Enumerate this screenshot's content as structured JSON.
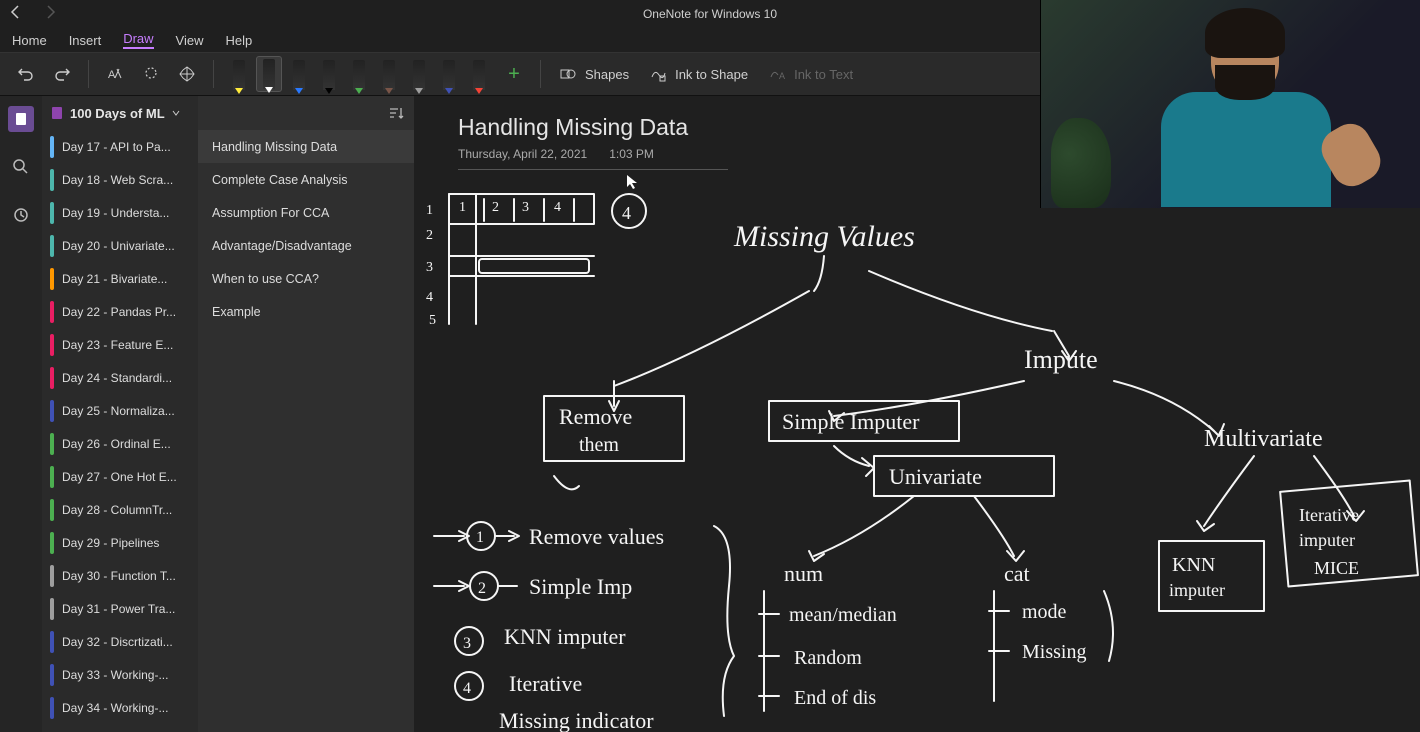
{
  "app_title": "OneNote for Windows 10",
  "menu": {
    "home": "Home",
    "insert": "Insert",
    "draw": "Draw",
    "view": "View",
    "help": "Help"
  },
  "toolbar": {
    "shapes": "Shapes",
    "ink_to_shape": "Ink to Shape",
    "ink_to_text": "Ink to Text"
  },
  "pens": [
    {
      "color": "#ffeb3b"
    },
    {
      "color": "#ffffff"
    },
    {
      "color": "#2979ff"
    },
    {
      "color": "#000000"
    },
    {
      "color": "#4caf50"
    },
    {
      "color": "#795548"
    },
    {
      "color": "#9e9e9e"
    },
    {
      "color": "#3f51b5"
    },
    {
      "color": "#f44336"
    }
  ],
  "notebook": "100 Days of ML",
  "sections": [
    {
      "label": "Day 17 - API to Pa...",
      "color": "#64b5f6"
    },
    {
      "label": "Day 18 - Web Scra...",
      "color": "#4db6ac"
    },
    {
      "label": "Day 19 - Understa...",
      "color": "#4db6ac"
    },
    {
      "label": "Day 20 - Univariate...",
      "color": "#4db6ac"
    },
    {
      "label": "Day 21 - Bivariate...",
      "color": "#ff9800"
    },
    {
      "label": "Day 22 - Pandas Pr...",
      "color": "#e91e63"
    },
    {
      "label": "Day 23 - Feature E...",
      "color": "#e91e63"
    },
    {
      "label": "Day 24 - Standardi...",
      "color": "#e91e63"
    },
    {
      "label": "Day 25 - Normaliza...",
      "color": "#3f51b5"
    },
    {
      "label": "Day 26 - Ordinal E...",
      "color": "#4caf50"
    },
    {
      "label": "Day 27 - One Hot E...",
      "color": "#4caf50"
    },
    {
      "label": "Day 28 - ColumnTr...",
      "color": "#4caf50"
    },
    {
      "label": "Day 29 - Pipelines",
      "color": "#4caf50"
    },
    {
      "label": "Day 30 - Function T...",
      "color": "#9e9e9e"
    },
    {
      "label": "Day 31 - Power Tra...",
      "color": "#9e9e9e"
    },
    {
      "label": "Day 32 - Discrtizati...",
      "color": "#3f51b5"
    },
    {
      "label": "Day 33 - Working-...",
      "color": "#3f51b5"
    },
    {
      "label": "Day 34 - Working-...",
      "color": "#3f51b5"
    }
  ],
  "pages": [
    {
      "label": "Handling Missing Data",
      "selected": true
    },
    {
      "label": "Complete Case Analysis",
      "selected": false
    },
    {
      "label": "Assumption For CCA",
      "selected": false
    },
    {
      "label": "Advantage/Disadvantage",
      "selected": false
    },
    {
      "label": "When to use CCA?",
      "selected": false
    },
    {
      "label": "Example",
      "selected": false
    }
  ],
  "page": {
    "title": "Handling Missing Data",
    "date": "Thursday, April 22, 2021",
    "time": "1:03 PM"
  },
  "ink_transcript": {
    "table_cols": "4",
    "table_rows": [
      "1",
      "2",
      "3",
      "4",
      "5"
    ],
    "root": "Missing Values",
    "branch_remove": "Remove them",
    "branch_impute": "Impute",
    "simple_imp": "Simple Imputer",
    "univariate": "Univariate",
    "multivariate": "Multivariate",
    "knn": "KNN imputer",
    "iterative": "Iterative imputer MICE",
    "steps": [
      "Remove values",
      "Simple Imp",
      "KNN imputer",
      "Iterative",
      "Missing indicator"
    ],
    "num_label": "num",
    "num_methods": [
      "mean/median",
      "Random",
      "End of dis"
    ],
    "cat_label": "cat",
    "cat_methods": [
      "mode",
      "Missing"
    ]
  }
}
